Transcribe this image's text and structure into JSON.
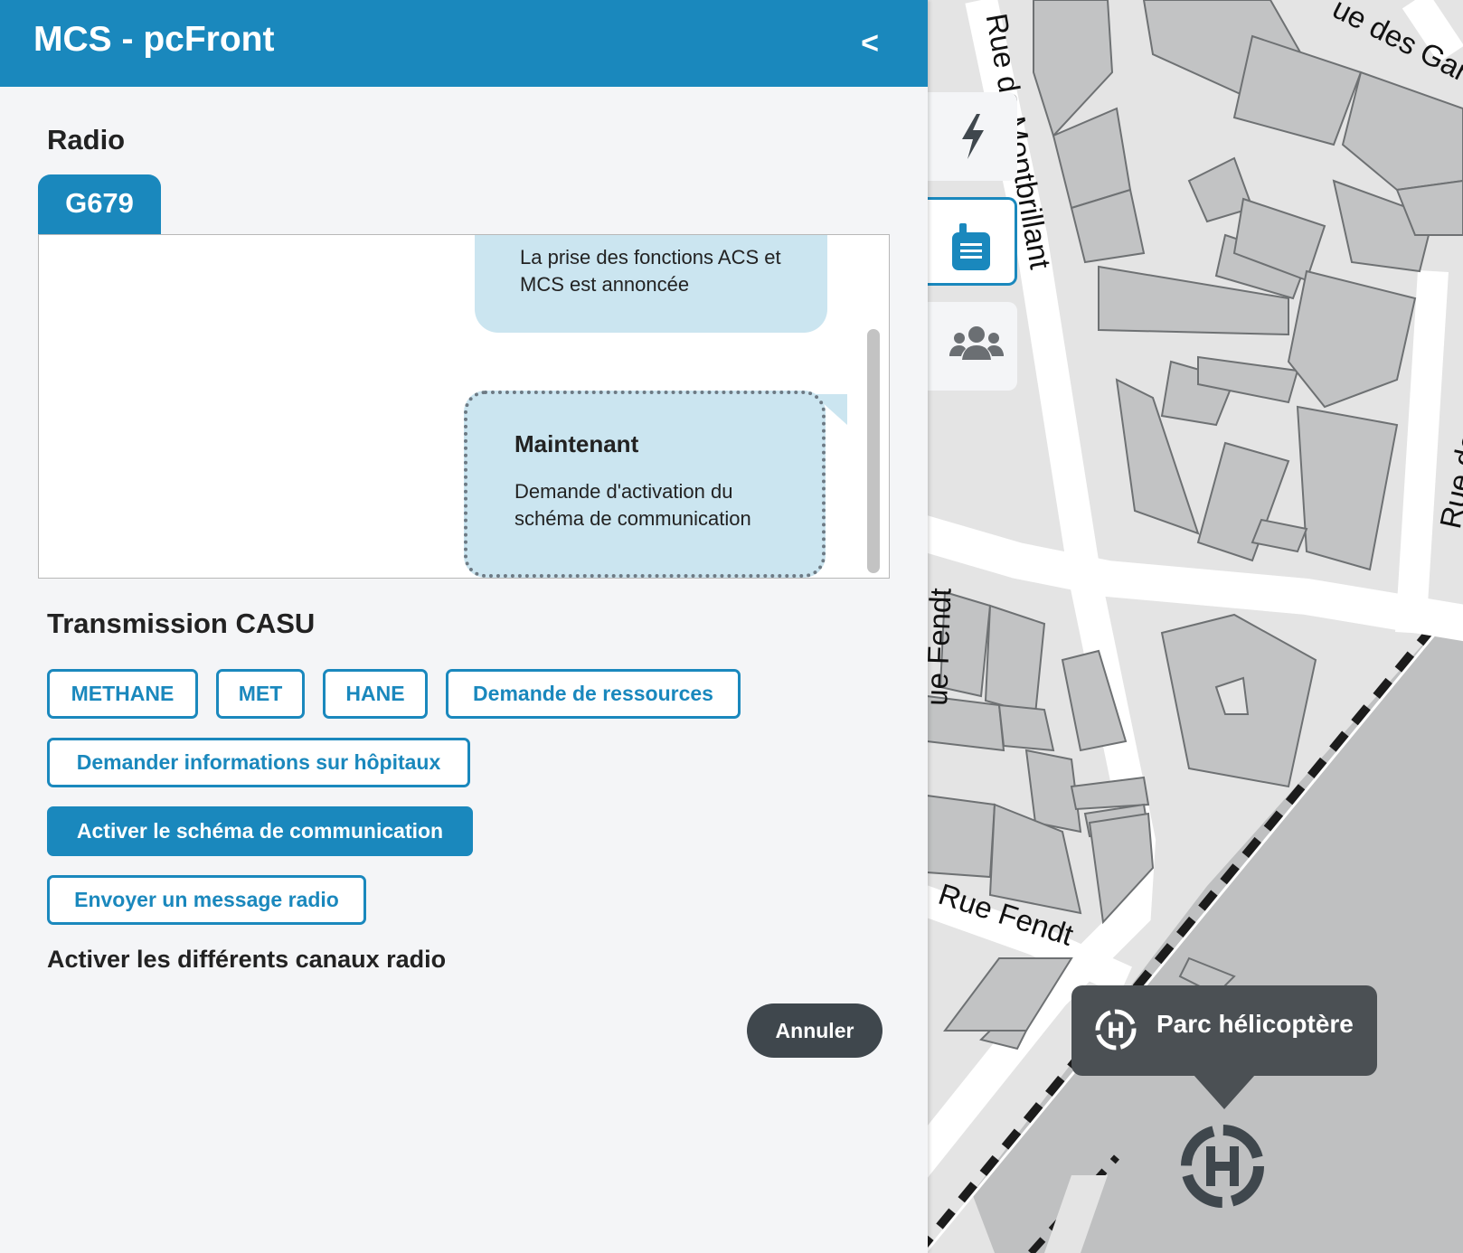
{
  "header": {
    "title": "MCS - pcFront",
    "collapse_label": "<"
  },
  "radio": {
    "title": "Radio",
    "tab": "G679",
    "messages": [
      {
        "text": "La prise des fonctions ACS et MCS est annoncée"
      },
      {
        "time": "Maintenant",
        "text": "Demande d'activation du schéma de communication"
      }
    ]
  },
  "casu": {
    "title": "Transmission CASU",
    "buttons": {
      "methane": "METHANE",
      "met": "MET",
      "hane": "HANE",
      "ressources": "Demande de ressources",
      "hopitaux": "Demander informations sur hôpitaux",
      "activer": "Activer le schéma de communication",
      "envoyer": "Envoyer un message radio"
    },
    "channels_label": "Activer les différents canaux radio",
    "cancel": "Annuler"
  },
  "tools": [
    {
      "icon": "lightning-icon"
    },
    {
      "icon": "radio-icon",
      "active": true
    },
    {
      "icon": "team-icon"
    }
  ],
  "map": {
    "streets": {
      "montbrillant": "Rue de Montbrillant",
      "gares_top": "ue des Gar",
      "gares_right": "Rue des Gar",
      "fendt_left": "ue Fendt",
      "fendt_bottom": "Rue Fendt"
    },
    "popup": {
      "label": "Parc hélicoptère",
      "icon": "helicopter-pad-icon"
    }
  },
  "colors": {
    "primary": "#1a88bd",
    "bubble": "#cbe5f0",
    "dark": "#3f474d",
    "map_bg": "#e4e4e4",
    "building": "#c2c3c4"
  }
}
